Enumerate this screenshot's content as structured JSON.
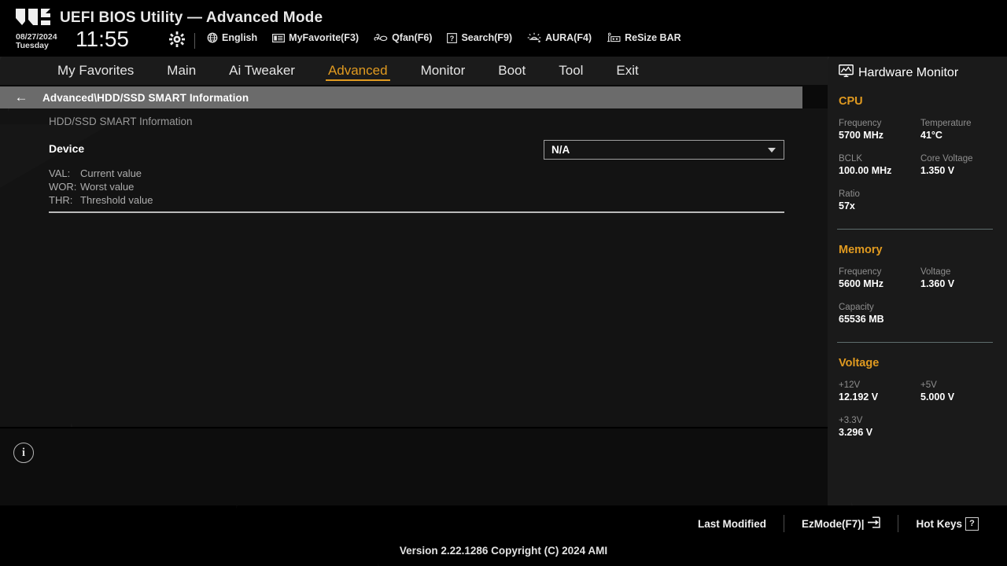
{
  "header": {
    "logo_icon": "tuf-gaming-logo",
    "title": "UEFI BIOS Utility — Advanced Mode",
    "date": "08/27/2024",
    "weekday": "Tuesday",
    "time": "11:55",
    "gear_icon": "gear-icon",
    "items": [
      {
        "icon": "globe-icon",
        "label": "English"
      },
      {
        "icon": "document-list-icon",
        "label": "MyFavorite(F3)"
      },
      {
        "icon": "fan-icon",
        "label": "Qfan(F6)"
      },
      {
        "icon": "question-box-icon",
        "label": "Search(F9)"
      },
      {
        "icon": "aura-lighting-icon",
        "label": "AURA(F4)"
      },
      {
        "icon": "resize-bar-icon",
        "label": "ReSize BAR"
      }
    ]
  },
  "nav": {
    "tabs": [
      {
        "label": "My Favorites",
        "active": false
      },
      {
        "label": "Main",
        "active": false
      },
      {
        "label": "Ai Tweaker",
        "active": false
      },
      {
        "label": "Advanced",
        "active": true
      },
      {
        "label": "Monitor",
        "active": false
      },
      {
        "label": "Boot",
        "active": false
      },
      {
        "label": "Tool",
        "active": false
      },
      {
        "label": "Exit",
        "active": false
      }
    ],
    "active_color": "#e09a20"
  },
  "breadcrumb": {
    "back_icon": "arrow-left-icon",
    "path": "Advanced\\HDD/SSD SMART Information"
  },
  "main": {
    "section_title": "HDD/SSD SMART Information",
    "device_row": {
      "label": "Device",
      "value": "N/A",
      "dropdown_icon": "chevron-down-icon"
    },
    "legend": [
      {
        "key": "VAL:",
        "text": "Current value"
      },
      {
        "key": "WOR:",
        "text": "Worst value"
      },
      {
        "key": "THR:",
        "text": "Threshold value"
      }
    ],
    "info_icon": "info-circle-icon"
  },
  "hardware_monitor": {
    "icon": "monitor-icon",
    "title": "Hardware Monitor",
    "groups": [
      {
        "name": "CPU",
        "color": "#e09a20",
        "metrics": [
          {
            "label": "Frequency",
            "value": "5700 MHz",
            "full": false
          },
          {
            "label": "Temperature",
            "value": "41°C",
            "full": false
          },
          {
            "label": "BCLK",
            "value": "100.00 MHz",
            "full": false
          },
          {
            "label": "Core Voltage",
            "value": "1.350 V",
            "full": false
          },
          {
            "label": "Ratio",
            "value": "57x",
            "full": true
          }
        ]
      },
      {
        "name": "Memory",
        "color": "#e09a20",
        "metrics": [
          {
            "label": "Frequency",
            "value": "5600 MHz",
            "full": false
          },
          {
            "label": "Voltage",
            "value": "1.360 V",
            "full": false
          },
          {
            "label": "Capacity",
            "value": "65536 MB",
            "full": true
          }
        ]
      },
      {
        "name": "Voltage",
        "color": "#e09a20",
        "metrics": [
          {
            "label": "+12V",
            "value": "12.192 V",
            "full": false
          },
          {
            "label": "+5V",
            "value": "5.000 V",
            "full": false
          },
          {
            "label": "+3.3V",
            "value": "3.296 V",
            "full": true
          }
        ]
      }
    ]
  },
  "footer": {
    "items": [
      {
        "label": "Last Modified",
        "icon": ""
      },
      {
        "label": "EzMode(F7)|",
        "icon": "arrow-into-box-icon"
      },
      {
        "label": "Hot Keys",
        "icon": "question-box-icon"
      }
    ],
    "version": "Version 2.22.1286 Copyright (C) 2024 AMI"
  }
}
